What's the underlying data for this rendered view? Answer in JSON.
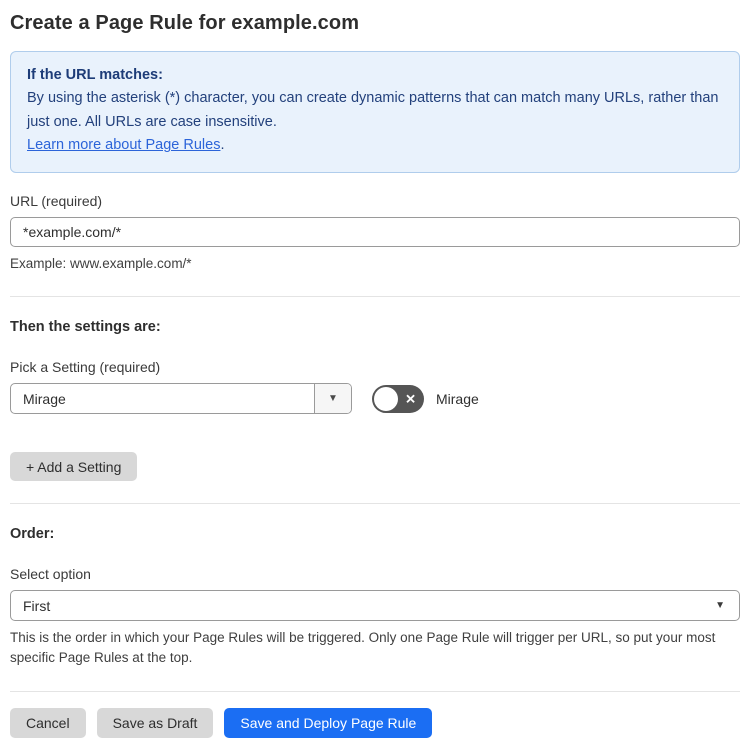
{
  "title": "Create a Page Rule for example.com",
  "info_box": {
    "heading": "If the URL matches:",
    "body": "By using the asterisk (*) character, you can create dynamic patterns that can match many URLs, rather than just one. All URLs are case insensitive.",
    "link_label": "Learn more about Page Rules",
    "link_suffix": "."
  },
  "url_field": {
    "label": "URL (required)",
    "value": "*example.com/*",
    "helper": "Example: www.example.com/*"
  },
  "settings": {
    "heading": "Then the settings are:",
    "pick_label": "Pick a Setting (required)",
    "selected_setting": "Mirage",
    "toggle_label": "Mirage",
    "toggle_state": "off",
    "add_button_label": "+ Add a Setting"
  },
  "order": {
    "heading": "Order:",
    "label": "Select option",
    "selected_option": "First",
    "helper": "This is the order in which your Page Rules will be triggered. Only one Page Rule will trigger per URL, so put your most specific Page Rules at the top."
  },
  "footer": {
    "cancel_label": "Cancel",
    "save_draft_label": "Save as Draft",
    "save_deploy_label": "Save and Deploy Page Rule"
  },
  "icons": {
    "toggle_off_x": "✕",
    "dropdown_arrow": "▼"
  },
  "colors": {
    "primary_blue": "#1b6ef3",
    "info_bg": "#e9f2fc",
    "info_border": "#b0cdec",
    "info_text": "#23417c",
    "link_blue": "#2c64d9",
    "toggle_off_bg": "#555555",
    "button_gray": "#d8d8d8"
  }
}
